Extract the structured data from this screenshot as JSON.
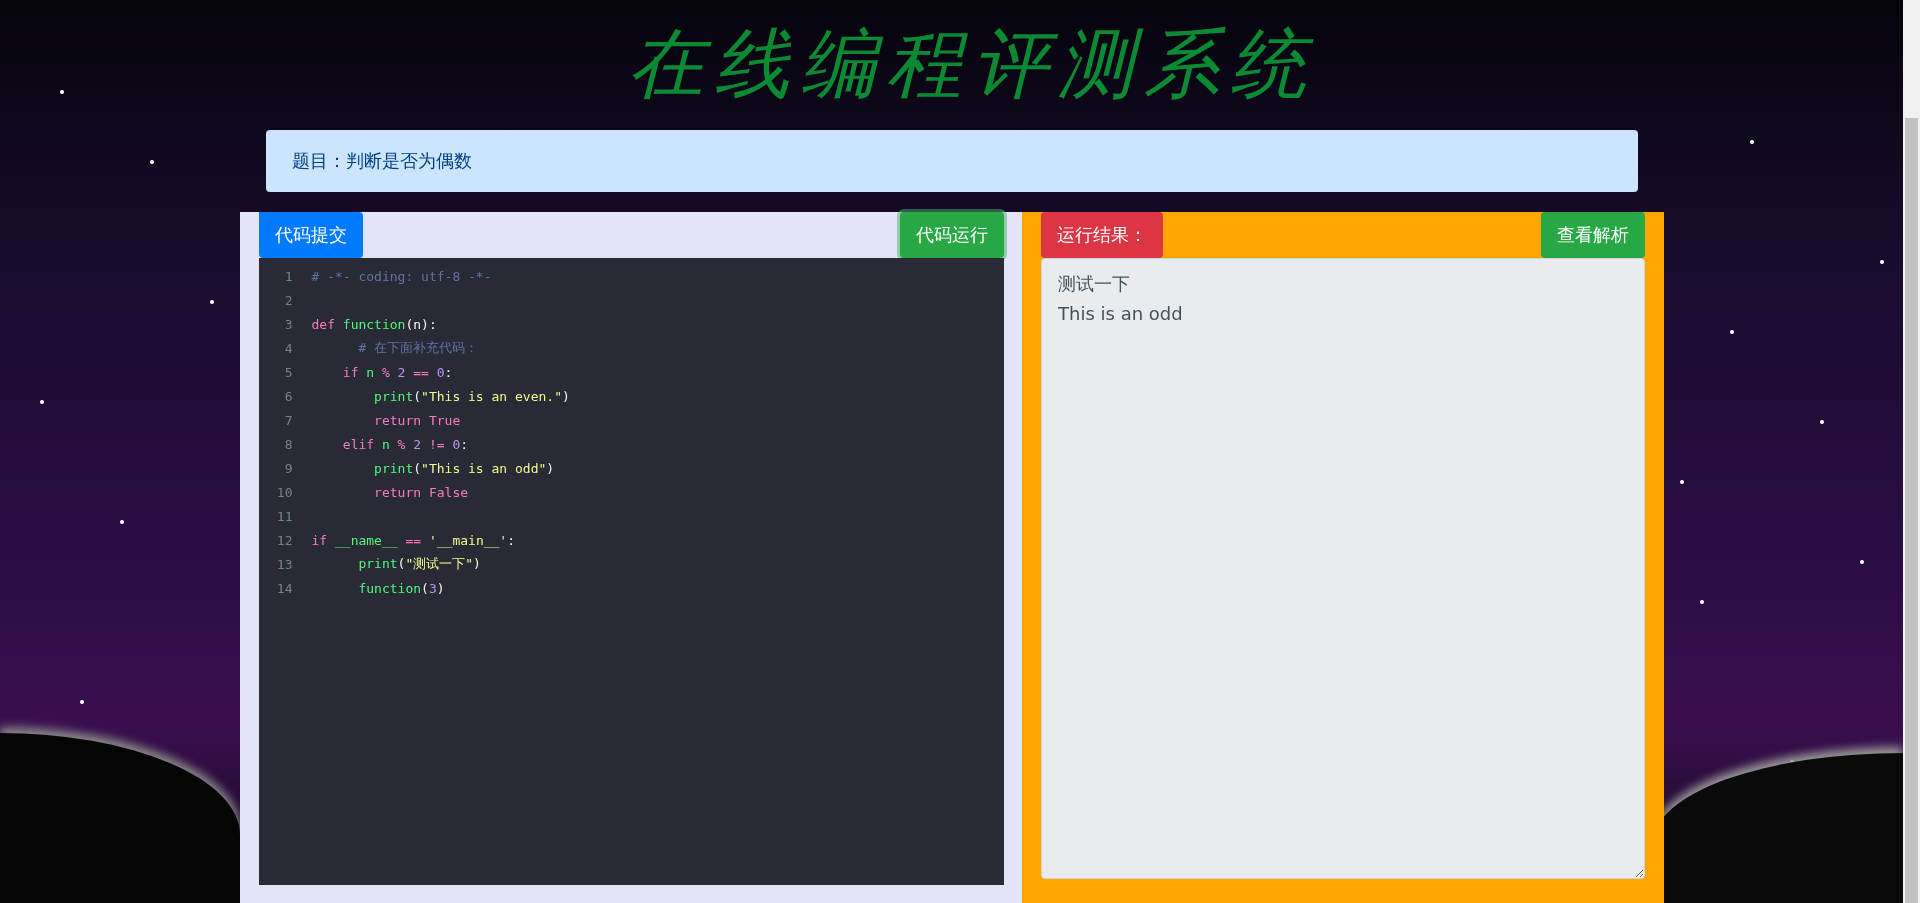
{
  "header": {
    "title": "在线编程评测系统"
  },
  "problem": {
    "label": "题目：判断是否为偶数"
  },
  "editor_panel": {
    "submit_button": "代码提交",
    "run_button": "代码运行",
    "lines": [
      {
        "number": "1",
        "tokens": [
          {
            "kind": "comment",
            "text": "# -*- coding: utf-8 -*-"
          }
        ]
      },
      {
        "number": "2"
      },
      {
        "number": "3",
        "tokens": [
          {
            "kind": "keyword",
            "text": "def "
          },
          {
            "kind": "func",
            "text": "function"
          },
          {
            "kind": "plain",
            "text": "(n):"
          }
        ]
      },
      {
        "number": "4",
        "tokens": [
          {
            "kind": "comment",
            "text": "      # 在下面补充代码："
          }
        ]
      },
      {
        "number": "5",
        "tokens": [
          {
            "kind": "keyword",
            "text": "    if "
          },
          {
            "kind": "func",
            "text": "n "
          },
          {
            "kind": "keyword",
            "text": "% "
          },
          {
            "kind": "number",
            "text": "2 "
          },
          {
            "kind": "keyword",
            "text": "== "
          },
          {
            "kind": "number",
            "text": "0"
          },
          {
            "kind": "plain",
            "text": ":"
          }
        ]
      },
      {
        "number": "6",
        "tokens": [
          {
            "kind": "func",
            "text": "        print"
          },
          {
            "kind": "plain",
            "text": "("
          },
          {
            "kind": "string",
            "text": "\"This is an even.\""
          },
          {
            "kind": "plain",
            "text": ")"
          }
        ]
      },
      {
        "number": "7",
        "tokens": [
          {
            "kind": "keyword",
            "text": "        return "
          },
          {
            "kind": "keyword",
            "text": "True"
          }
        ]
      },
      {
        "number": "8",
        "tokens": [
          {
            "kind": "keyword",
            "text": "    elif "
          },
          {
            "kind": "func",
            "text": "n "
          },
          {
            "kind": "keyword",
            "text": "% "
          },
          {
            "kind": "number",
            "text": "2 "
          },
          {
            "kind": "keyword",
            "text": "!= "
          },
          {
            "kind": "number",
            "text": "0"
          },
          {
            "kind": "plain",
            "text": ":"
          }
        ]
      },
      {
        "number": "9",
        "tokens": [
          {
            "kind": "func",
            "text": "        print"
          },
          {
            "kind": "plain",
            "text": "("
          },
          {
            "kind": "string",
            "text": "\"This is an odd\""
          },
          {
            "kind": "plain",
            "text": ")"
          }
        ]
      },
      {
        "number": "10",
        "tokens": [
          {
            "kind": "keyword",
            "text": "        return "
          },
          {
            "kind": "keyword",
            "text": "False"
          }
        ]
      },
      {
        "number": "11"
      },
      {
        "number": "12",
        "tokens": [
          {
            "kind": "keyword",
            "text": "if "
          },
          {
            "kind": "func",
            "text": "__name__ "
          },
          {
            "kind": "keyword",
            "text": "== "
          },
          {
            "kind": "string",
            "text": "'__main__'"
          },
          {
            "kind": "plain",
            "text": ":"
          }
        ]
      },
      {
        "number": "13",
        "tokens": [
          {
            "kind": "func",
            "text": "      print"
          },
          {
            "kind": "plain",
            "text": "("
          },
          {
            "kind": "string",
            "text": "\"测试一下\""
          },
          {
            "kind": "plain",
            "text": ")"
          }
        ]
      },
      {
        "number": "14",
        "tokens": [
          {
            "kind": "func",
            "text": "      function"
          },
          {
            "kind": "plain",
            "text": "("
          },
          {
            "kind": "number",
            "text": "3"
          },
          {
            "kind": "plain",
            "text": ")"
          }
        ]
      }
    ]
  },
  "result_panel": {
    "label": "运行结果：",
    "analysis_button": "查看解析",
    "output": "测试一下\nThis is an odd"
  }
}
